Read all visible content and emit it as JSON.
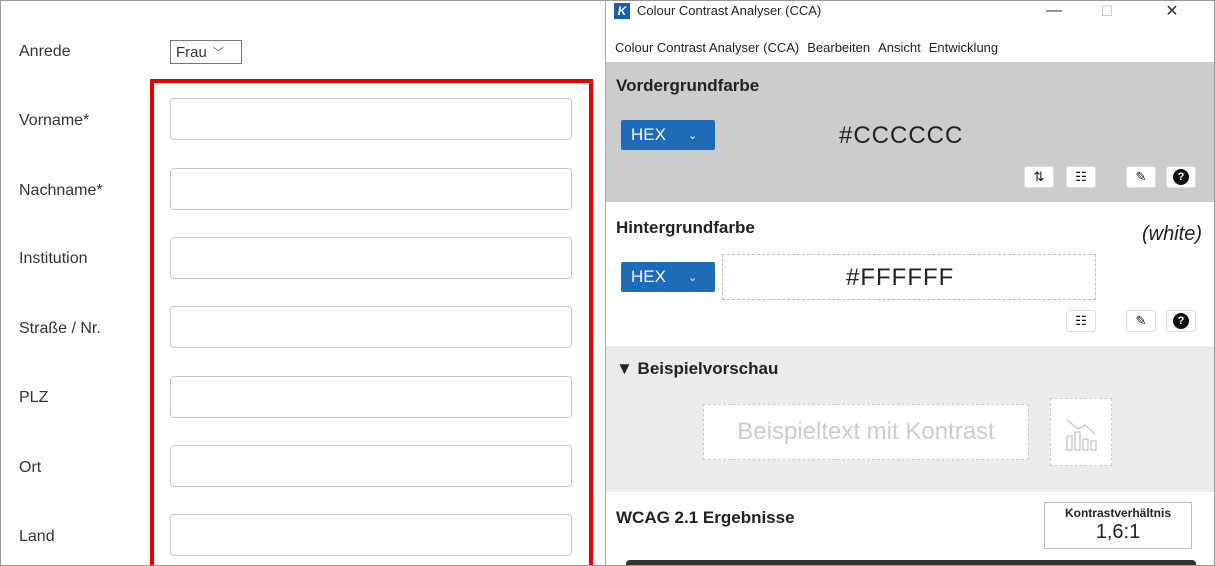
{
  "form": {
    "fields": [
      {
        "label": "Anrede"
      },
      {
        "label": "Vorname*",
        "value": ""
      },
      {
        "label": "Nachname*",
        "value": ""
      },
      {
        "label": "Institution",
        "value": ""
      },
      {
        "label": "Straße / Nr.",
        "value": ""
      },
      {
        "label": "PLZ",
        "value": ""
      },
      {
        "label": "Ort",
        "value": ""
      },
      {
        "label": "Land",
        "value": ""
      }
    ],
    "anrede_selected": "Frau",
    "highlight_color": "#e60000"
  },
  "cca": {
    "window_title": "Colour Contrast Analyser (CCA)",
    "app_icon_glyph": "K",
    "window_controls": {
      "minimize": "—",
      "maximize": "☐",
      "close": "✕"
    },
    "menu": [
      "Colour Contrast Analyser (CCA)",
      "Bearbeiten",
      "Ansicht",
      "Entwicklung"
    ],
    "foreground": {
      "heading": "Vordergrundfarbe",
      "format": "HEX",
      "value": "#CCCCCC",
      "tools": [
        "swap-icon",
        "sliders-icon",
        "eyedropper-icon",
        "help-icon"
      ]
    },
    "background": {
      "heading": "Hintergrundfarbe",
      "color_name": "(white)",
      "format": "HEX",
      "value": "#FFFFFF",
      "tools": [
        "sliders-icon",
        "eyedropper-icon",
        "help-icon"
      ]
    },
    "preview": {
      "heading": "▼ Beispielvorschau",
      "sample_text": "Beispieltext mit Kontrast",
      "icon": "chart-icon"
    },
    "wcag": {
      "heading": "WCAG 2.1 Ergebnisse",
      "ratio_label": "Kontrastverhältnis",
      "ratio_value": "1,6:1"
    },
    "colors": {
      "accent": "#1e6bb8",
      "fg_panel": "#cccccc",
      "preview_panel": "#ebebeb"
    }
  }
}
